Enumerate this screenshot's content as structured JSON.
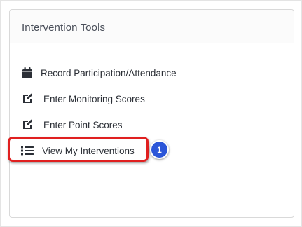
{
  "panel": {
    "title": "Intervention Tools"
  },
  "items": [
    {
      "label": "Record Participation/Attendance",
      "icon": "calendar-icon"
    },
    {
      "label": "Enter Monitoring Scores",
      "icon": "edit-icon"
    },
    {
      "label": "Enter Point Scores",
      "icon": "edit-icon"
    },
    {
      "label": "View My Interventions",
      "icon": "list-icon"
    }
  ],
  "annotation": {
    "step_number": "1",
    "highlight_color": "#e02020",
    "badge_color": "#2c56d8"
  }
}
